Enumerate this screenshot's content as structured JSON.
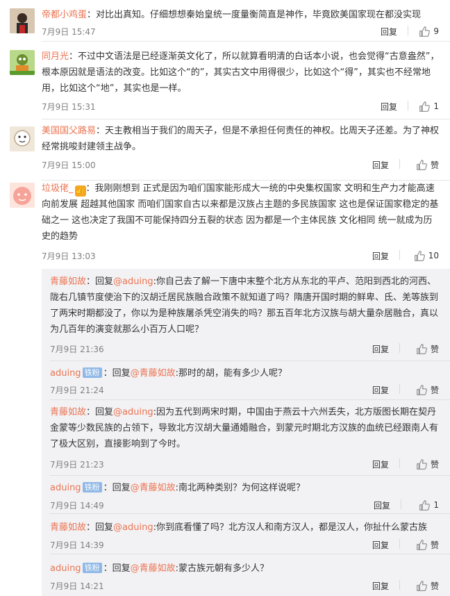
{
  "accent": "#eb7350",
  "comments": [
    {
      "user": "帝都小鸡蛋",
      "text": "：对比出真知。仔细想想秦始皇统一度量衡简直是神作，毕竟欧美国家现在都没实现",
      "time": "7月9日 15:47",
      "reply": "回复",
      "like": "9"
    },
    {
      "user": "同月光",
      "text": "：不过中文语法是已经逐渐英文化了，所以就算看明清的白话本小说，也会觉得“古意盎然”，根本原因就是语法的改变。比如这个“的”，其实古文中用得很少，比如这个“得”，其实也不经常地用，比如这个“地”，其实也是一样。",
      "time": "7月9日 15:31",
      "reply": "回复",
      "like": "1"
    },
    {
      "user": "美国国父路易",
      "text": "：天主教相当于我们的周天子，但是不承担任何责任的神权。比周天子还差。为了神权经常挑唆封建领主战争。",
      "time": "7月9日 15:00",
      "reply": "回复",
      "like": "赞"
    },
    {
      "user": "垃圾佬_",
      "badge": "👍",
      "text": "：我刚刚想到 正式是因为咱们国家能形成大一统的中央集权国家 文明和生产力才能高速向前发展 超越其他国家 而咱们国家自古以来都是汉族占主题的多民族国家 这也是保证国家稳定的基础之一 这也决定了我国不可能保持四分五裂的状态 因为都是一个主体民族 文化相同 统一就成为历史的趋势",
      "time": "7月9日 13:03",
      "reply": "回复",
      "like": "10"
    }
  ],
  "replies": [
    {
      "user": "青藤如故",
      "prefix": "：回复",
      "target": "@aduing",
      "text": ":你自己去了解一下唐中末整个北方从东北的平卢、范阳到西北的河西、陇右几镇节度使治下的汉胡迁居民族融合政策不就知道了吗？隋唐开国时期的鲜卑、氐、羌等族到了两宋时期都没了，你以为是种族屠杀凭空消失的吗？那五百年北方汉族与胡大量杂居融合，真以为几百年的演变就那么小百万人口呢？",
      "time": "7月9日 21:36",
      "reply": "回复",
      "like": "赞"
    },
    {
      "user": "aduing",
      "tag": "铁粉",
      "prefix": "：回复",
      "target": "@青藤如故",
      "text": ":那时的胡，能有多少人呢？",
      "time": "7月9日 21:24",
      "reply": "回复",
      "like": "赞"
    },
    {
      "user": "青藤如故",
      "prefix": "：回复",
      "target": "@aduing",
      "text": ":因为五代到两宋时期，中国由于燕云十六州丢失，北方版图长期在契丹金蒙等少数民族的占领下，导致北方汉胡大量通婚融合，到蒙元时期北方汉族的血统已经跟南人有了极大区别，直接影响到了今时。",
      "time": "7月9日 21:23",
      "reply": "回复",
      "like": "赞"
    },
    {
      "user": "aduing",
      "tag": "铁粉",
      "prefix": "：回复",
      "target": "@青藤如故",
      "text": ":南北两种类别？为何这样说呢？",
      "time": "7月9日 14:49",
      "reply": "回复",
      "like": "1"
    },
    {
      "user": "青藤如故",
      "prefix": "：回复",
      "target": "@aduing",
      "text": ":你到底看懂了吗？北方汉人和南方汉人，都是汉人，你扯什么蒙古族",
      "time": "7月9日 14:39",
      "reply": "回复",
      "like": "赞"
    },
    {
      "user": "aduing",
      "tag": "铁粉",
      "prefix": "：回复",
      "target": "@青藤如故",
      "text": ":蒙古族元朝有多少人？",
      "time": "7月9日 14:21",
      "reply": "回复",
      "like": "赞"
    }
  ]
}
